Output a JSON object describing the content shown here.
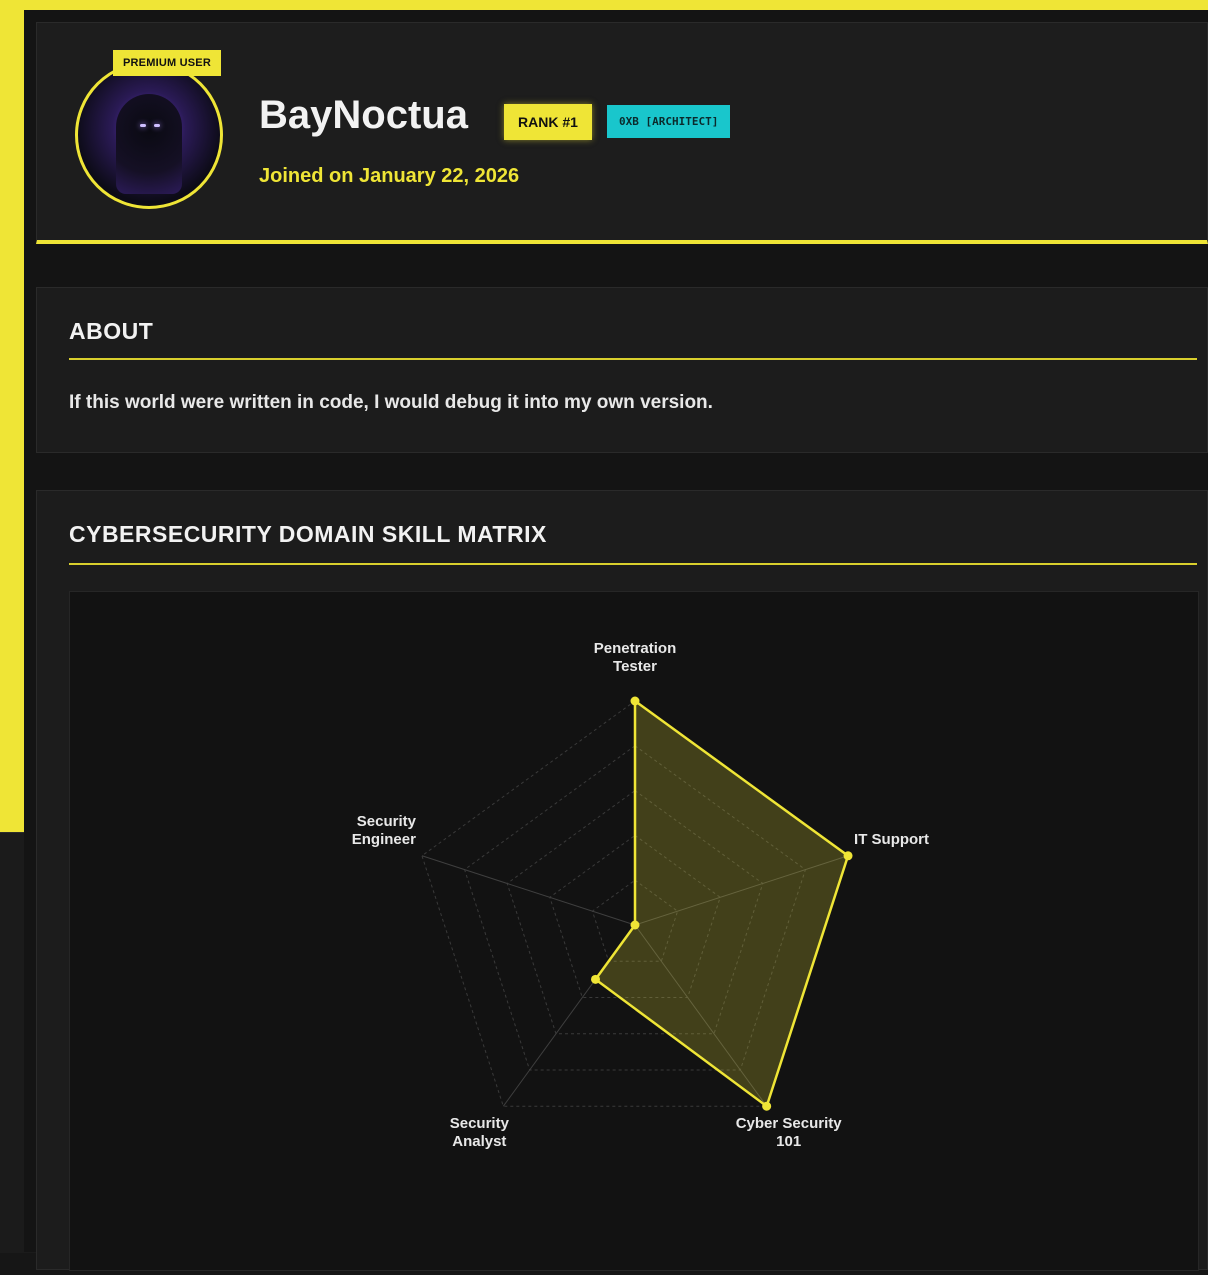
{
  "profile": {
    "premium_label": "PREMIUM USER",
    "username": "BayNoctua",
    "rank_label": "RANK #1",
    "role_label": "0XB [ARCHITECT]",
    "joined": "Joined on January 22, 2026"
  },
  "about": {
    "title": "ABOUT",
    "text": "If this world were written in code, I would debug it into my own version."
  },
  "skills": {
    "title": "CYBERSECURITY DOMAIN SKILL MATRIX"
  },
  "colors": {
    "accent": "#efe536",
    "teal": "#19c6cc",
    "bg": "#141414"
  },
  "chart_data": {
    "type": "radar",
    "categories": [
      [
        "Penetration",
        "Tester"
      ],
      [
        "IT Support"
      ],
      [
        "Cyber Security",
        "101"
      ],
      [
        "Security",
        "Analyst"
      ],
      [
        "Security",
        "Engineer"
      ]
    ],
    "values": [
      100,
      100,
      100,
      30,
      0
    ],
    "range": [
      0,
      100
    ],
    "grid_levels": 5
  }
}
